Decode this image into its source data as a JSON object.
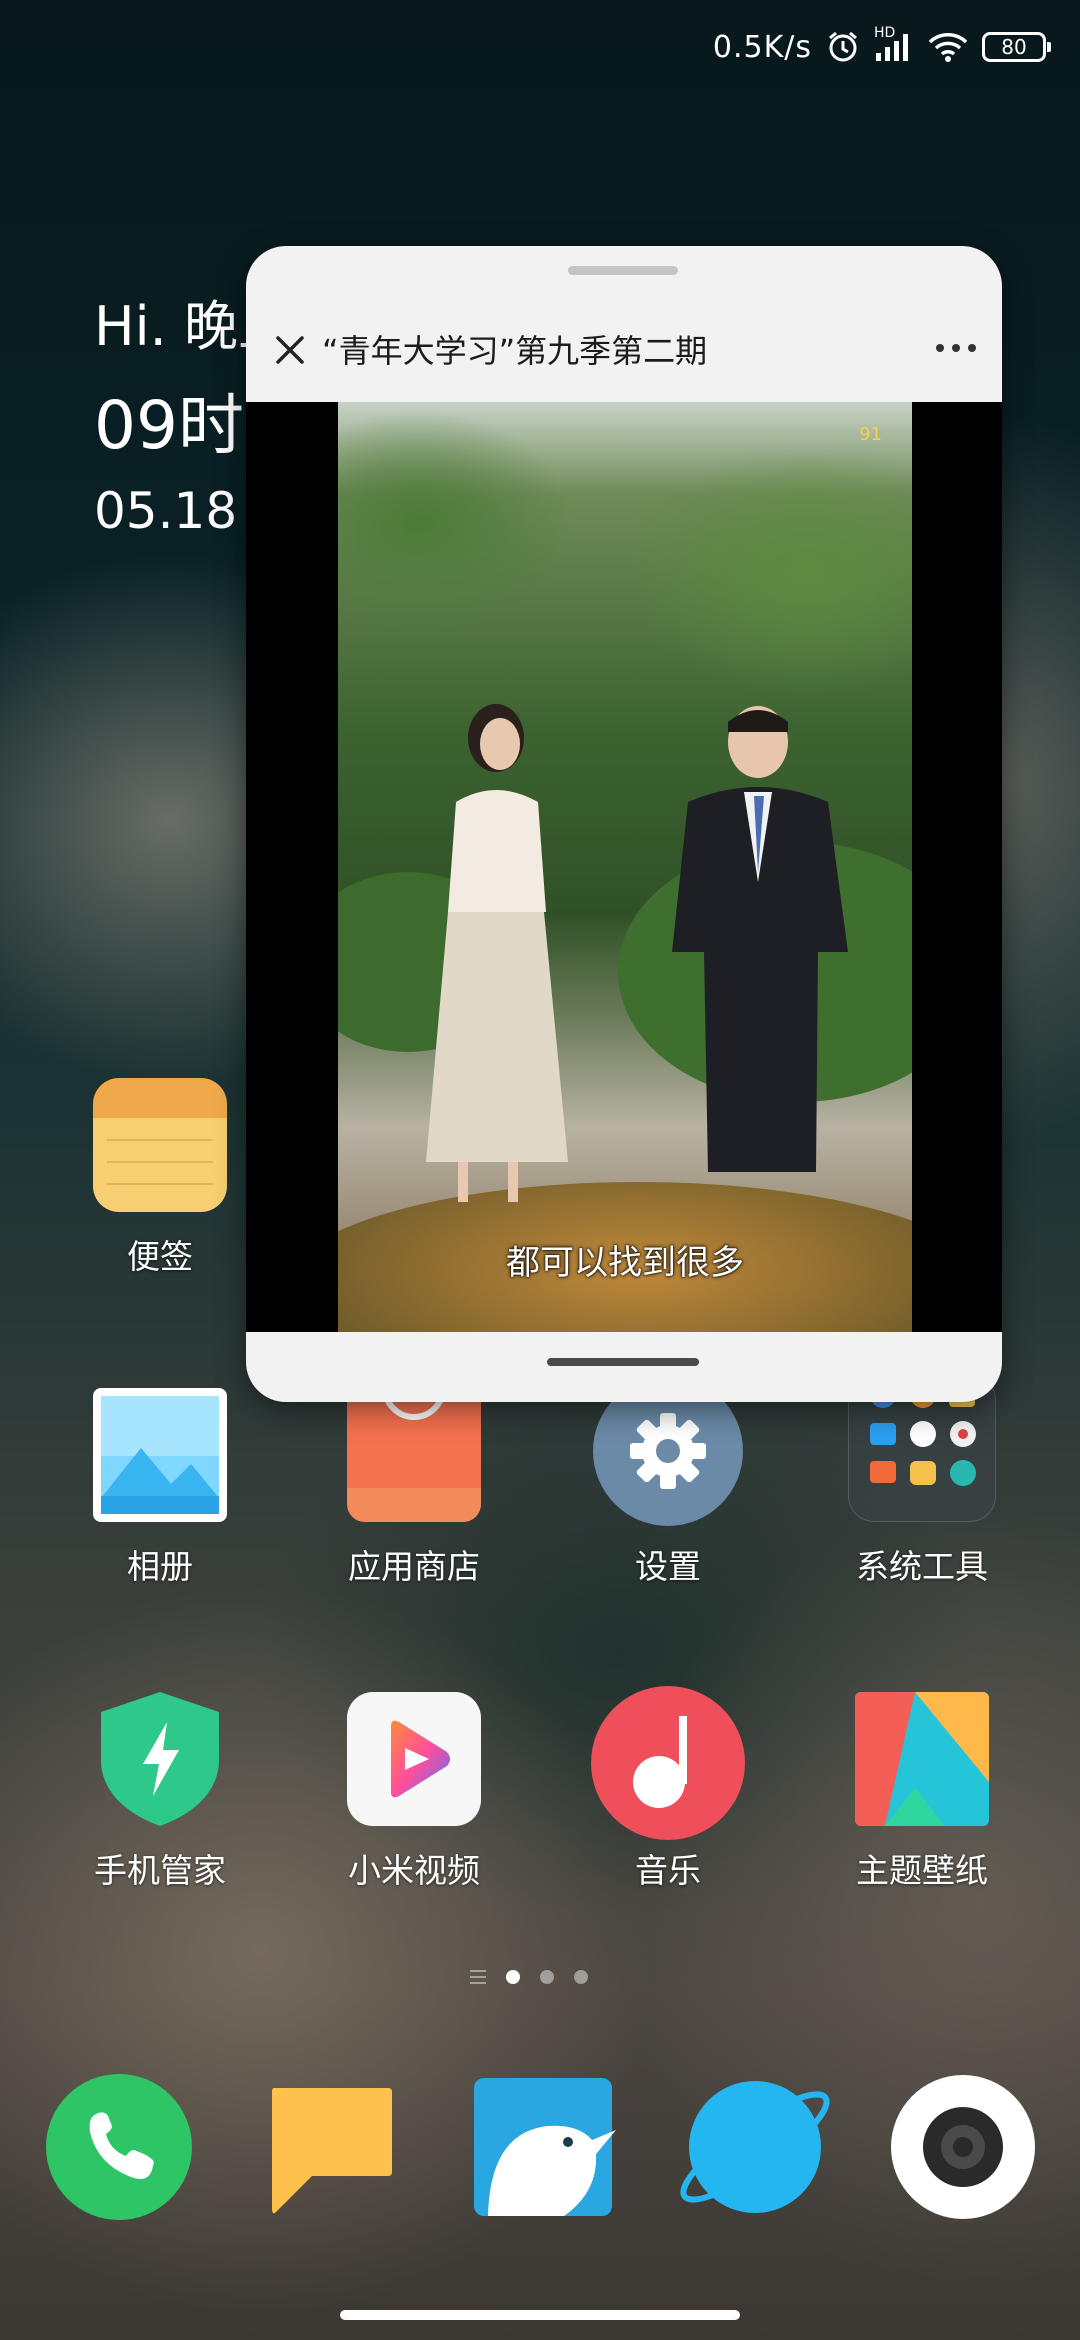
{
  "status_bar": {
    "net_speed": "0.5K/s",
    "signal_label": "HD",
    "battery": "80",
    "icons": [
      "alarm-icon",
      "signal-icon",
      "wifi-icon",
      "battery-icon"
    ]
  },
  "clock_widget": {
    "greeting": "Hi. 晚上",
    "time": "09时",
    "date": "05.18"
  },
  "floating_window": {
    "title": "“青年大学习”第九季第二期",
    "subtitle": "都可以找到很多",
    "watermark": "91"
  },
  "apps": [
    {
      "label": "便签",
      "icon": "notes-icon"
    },
    {
      "label": "相册",
      "icon": "gallery-icon"
    },
    {
      "label": "应用商店",
      "icon": "app-store-icon"
    },
    {
      "label": "设置",
      "icon": "settings-gear-icon"
    },
    {
      "label": "系统工具",
      "icon": "system-tools-folder-icon"
    },
    {
      "label": "手机管家",
      "icon": "security-shield-icon"
    },
    {
      "label": "小米视频",
      "icon": "video-play-icon"
    },
    {
      "label": "音乐",
      "icon": "music-note-icon"
    },
    {
      "label": "主题壁纸",
      "icon": "themes-icon"
    }
  ],
  "page_indicator": {
    "pages": 3,
    "current": 1
  },
  "dock": [
    "phone-icon",
    "messages-icon",
    "browser-kiwi-icon",
    "browser-planet-icon",
    "camera-icon"
  ],
  "colors": {
    "notes": "#f4c266",
    "appstore": "#f4714f",
    "settings": "#6b8aa8",
    "security": "#2dc88a",
    "music": "#ef4f5a",
    "phone": "#2ec566",
    "messages": "#ffc24d",
    "browser": "#24b6f0"
  }
}
